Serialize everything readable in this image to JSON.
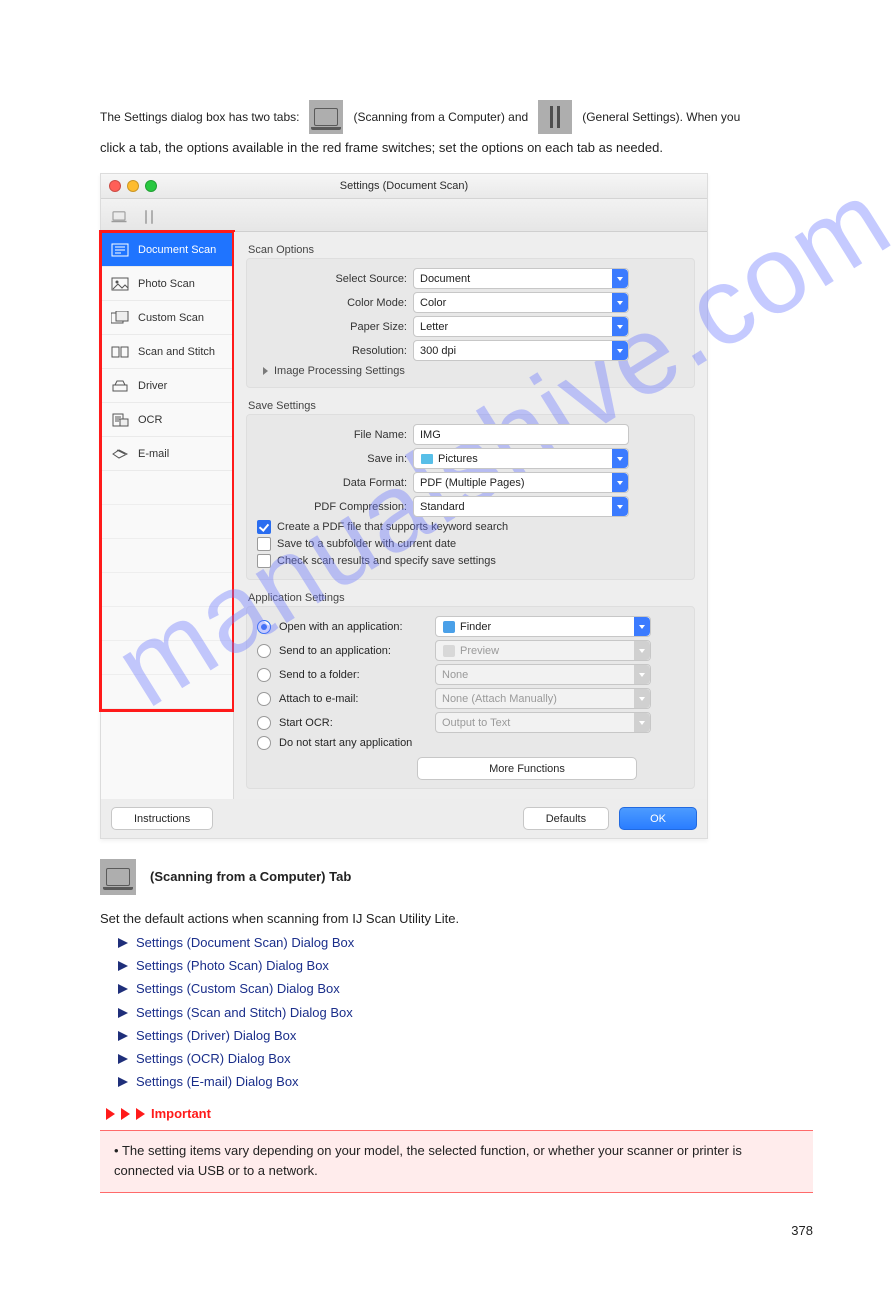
{
  "watermark": "manualshive.com",
  "intro": {
    "pre": "The Settings dialog box has two tabs:",
    "mid": " (Scanning from a Computer) and ",
    "post": " (General Settings). When you",
    "line2": "click a tab, the options available in the red frame switches; set the options on each tab as needed."
  },
  "dialog": {
    "title": "Settings (Document Scan)"
  },
  "sidebar": {
    "items": [
      {
        "label": "Document Scan",
        "selected": true,
        "icon": "document-scan"
      },
      {
        "label": "Photo Scan",
        "icon": "photo-scan"
      },
      {
        "label": "Custom Scan",
        "icon": "custom-scan"
      },
      {
        "label": "Scan and Stitch",
        "icon": "scan-stitch"
      },
      {
        "label": "Driver",
        "icon": "driver"
      },
      {
        "label": "OCR",
        "icon": "ocr"
      },
      {
        "label": "E-mail",
        "icon": "email"
      }
    ]
  },
  "scanOptions": {
    "heading": "Scan Options",
    "selectSource": {
      "label": "Select Source:",
      "value": "Document"
    },
    "colorMode": {
      "label": "Color Mode:",
      "value": "Color"
    },
    "paperSize": {
      "label": "Paper Size:",
      "value": "Letter"
    },
    "resolution": {
      "label": "Resolution:",
      "value": "300 dpi"
    },
    "imageProcessing": "Image Processing Settings"
  },
  "saveSettings": {
    "heading": "Save Settings",
    "fileName": {
      "label": "File Name:",
      "value": "IMG"
    },
    "saveIn": {
      "label": "Save in:",
      "value": "Pictures"
    },
    "dataFormat": {
      "label": "Data Format:",
      "value": "PDF (Multiple Pages)"
    },
    "pdfCompression": {
      "label": "PDF Compression:",
      "value": "Standard"
    },
    "chkKeyword": "Create a PDF file that supports keyword search",
    "chkSubfolder": "Save to a subfolder with current date",
    "chkCheckResults": "Check scan results and specify save settings"
  },
  "appSettings": {
    "heading": "Application Settings",
    "openWith": {
      "label": "Open with an application:",
      "value": "Finder"
    },
    "sendToApp": {
      "label": "Send to an application:",
      "value": "Preview"
    },
    "sendToFolder": {
      "label": "Send to a folder:",
      "value": "None"
    },
    "attachEmail": {
      "label": "Attach to e-mail:",
      "value": "None (Attach Manually)"
    },
    "startOCR": {
      "label": "Start OCR:",
      "value": "Output to Text"
    },
    "doNotStart": "Do not start any application",
    "moreFunctions": "More Functions"
  },
  "footer": {
    "instructions": "Instructions",
    "defaults": "Defaults",
    "ok": "OK"
  },
  "tabInfo": {
    "title": " (Scanning from a Computer) Tab",
    "lead": "Set the default actions when scanning from IJ Scan Utility Lite.",
    "links": [
      "Settings (Document Scan) Dialog Box",
      "Settings (Photo Scan) Dialog Box",
      "Settings (Custom Scan) Dialog Box",
      "Settings (Scan and Stitch) Dialog Box",
      "Settings (Driver) Dialog Box",
      "Settings (OCR) Dialog Box",
      "Settings (E-mail) Dialog Box"
    ]
  },
  "imp": {
    "label": "Important",
    "text": "The setting items vary depending on your model, the selected function, or whether your scanner or printer is connected via USB or to a network."
  },
  "pageNum": "378"
}
